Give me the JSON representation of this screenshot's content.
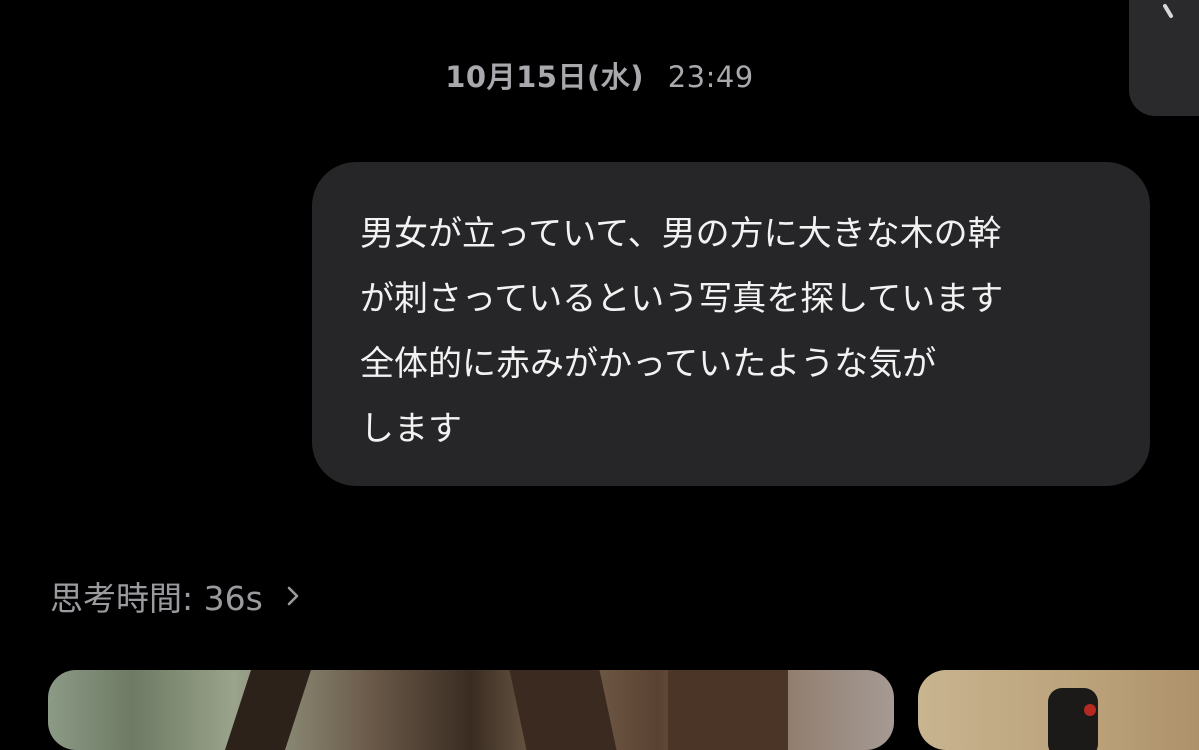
{
  "header": {
    "date": "10月15日(水)",
    "time": "23:49"
  },
  "message": {
    "lines": [
      "男女が立っていて、男の方に大きな木の幹",
      "が刺さっているという写真を探しています",
      "全体的に赤みがかっていたような気が",
      "します"
    ]
  },
  "thinking": {
    "label": "思考時間: 36s",
    "icon": "chevron-right-icon"
  },
  "colors": {
    "background": "#000000",
    "bubble": "#262628",
    "timestamp": "#a8a8ad",
    "thinking_text": "#9a9a9f"
  }
}
